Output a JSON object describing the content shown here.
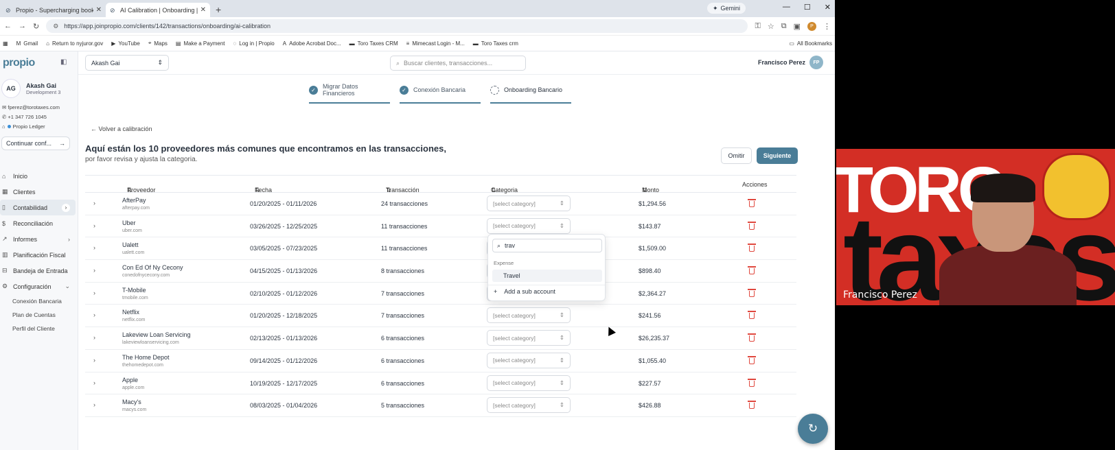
{
  "browser": {
    "tabs": [
      {
        "title": "Propio - Supercharging bookk",
        "active": false
      },
      {
        "title": "AI Calibration | Onboarding | P",
        "active": true
      }
    ],
    "gemini_label": "Gemini",
    "url": "https://app.joinpropio.com/clients/142/transactions/onboarding/ai-calibration",
    "bookmarks": [
      "Gmail",
      "Return to nyjuror.gov",
      "YouTube",
      "Maps",
      "Make a Payment",
      "Log in | Propio",
      "Adobe Acrobat Doc...",
      "Toro Taxes CRM",
      "Mimecast Login - M...",
      "Toro Taxes crm"
    ],
    "all_bookmarks": "All Bookmarks"
  },
  "sidebar": {
    "logo": "propio",
    "user": {
      "initials": "AG",
      "name": "Akash Gai",
      "role": "Development 3"
    },
    "contact": {
      "email": "fperez@torotaxes.com",
      "phone": "+1 347 726 1045",
      "ledger": "Propio Ledger"
    },
    "continue_label": "Continuar conf...",
    "menu": [
      {
        "label": "Inicio",
        "icon": "home-icon"
      },
      {
        "label": "Clientes",
        "icon": "clients-icon"
      },
      {
        "label": "Contabilidad",
        "icon": "book-icon",
        "active": true
      },
      {
        "label": "Reconciliación",
        "icon": "dollar-icon"
      },
      {
        "label": "Informes",
        "icon": "chart-icon"
      },
      {
        "label": "Planificación Fiscal",
        "icon": "calculator-icon"
      },
      {
        "label": "Bandeja de Entrada",
        "icon": "inbox-icon"
      },
      {
        "label": "Configuración",
        "icon": "gear-icon"
      }
    ],
    "submenu": [
      "Conexión Bancaria",
      "Plan de Cuentas",
      "Perfil del Cliente"
    ]
  },
  "topbar": {
    "client": "Akash Gai",
    "search_placeholder": "Buscar clientes, transacciones...",
    "user_name": "Francisco Perez",
    "user_initials": "FP"
  },
  "stepper": [
    {
      "label": "Migrar Datos Financieros",
      "state": "done"
    },
    {
      "label": "Conexión Bancaria",
      "state": "done"
    },
    {
      "label": "Onboarding Bancario",
      "state": "current"
    }
  ],
  "page": {
    "back": "Volver a calibración",
    "heading": "Aquí están los 10 proveedores más comunes que encontramos en las transacciones,",
    "subheading": "por favor revisa y ajusta la categoria.",
    "omit": "Omitir",
    "next": "Siguiente"
  },
  "table": {
    "headers": {
      "vendor": "Proveedor",
      "date": "Fecha",
      "tx": "Transacción",
      "category": "Categoria",
      "amount": "Monto",
      "actions": "Acciones"
    },
    "category_placeholder": "[select category]",
    "rows": [
      {
        "name": "AfterPay",
        "domain": "afterpay.com",
        "date": "01/20/2025 - 01/11/2026",
        "tx": "24 transacciones",
        "amount": "$1,294.56"
      },
      {
        "name": "Uber",
        "domain": "uber.com",
        "date": "03/26/2025 - 12/25/2025",
        "tx": "11 transacciones",
        "amount": "$143.87"
      },
      {
        "name": "Ualett",
        "domain": "ualett.com",
        "date": "03/05/2025 - 07/23/2025",
        "tx": "11 transacciones",
        "amount": "$1,509.00"
      },
      {
        "name": "Con Ed Of Ny Cecony",
        "domain": "conedofnycecony.com",
        "date": "04/15/2025 - 01/13/2026",
        "tx": "8 transacciones",
        "amount": "$898.40"
      },
      {
        "name": "T-Mobile",
        "domain": "tmobile.com",
        "date": "02/10/2025 - 01/12/2026",
        "tx": "7 transacciones",
        "amount": "$2,364.27"
      },
      {
        "name": "Netflix",
        "domain": "netflix.com",
        "date": "01/20/2025 - 12/18/2025",
        "tx": "7 transacciones",
        "amount": "$241.56"
      },
      {
        "name": "Lakeview Loan Servicing",
        "domain": "lakeviewloanservicing.com",
        "date": "02/13/2025 - 01/13/2026",
        "tx": "6 transacciones",
        "amount": "$26,235.37"
      },
      {
        "name": "The Home Depot",
        "domain": "thehomedepot.com",
        "date": "09/14/2025 - 01/12/2026",
        "tx": "6 transacciones",
        "amount": "$1,055.40"
      },
      {
        "name": "Apple",
        "domain": "apple.com",
        "date": "10/19/2025 - 12/17/2025",
        "tx": "6 transacciones",
        "amount": "$227.57"
      },
      {
        "name": "Macy's",
        "domain": "macys.com",
        "date": "08/03/2025 - 01/04/2026",
        "tx": "5 transacciones",
        "amount": "$426.88"
      }
    ]
  },
  "dropdown": {
    "search_value": "trav",
    "group": "Expense",
    "option": "Travel",
    "add": "Add a sub account"
  },
  "video": {
    "brand_top": "TORO",
    "brand_bottom": "taxes",
    "participant": "Francisco Perez"
  }
}
